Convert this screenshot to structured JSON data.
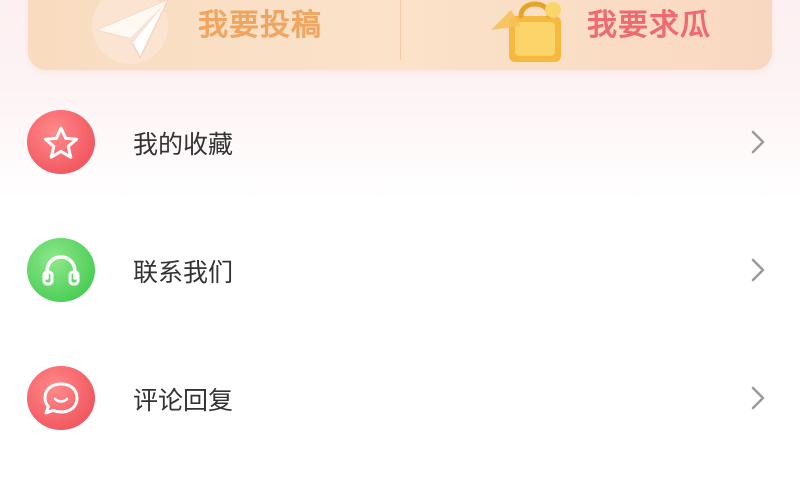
{
  "banner": {
    "submit_label": "我要投稿",
    "request_label": "我要求瓜"
  },
  "menu": {
    "items": [
      {
        "label": "我的收藏",
        "icon": "star-icon",
        "color": "#f25a63"
      },
      {
        "label": "联系我们",
        "icon": "headset-icon",
        "color": "#4fcf5a"
      },
      {
        "label": "评论回复",
        "icon": "chat-bubble-icon",
        "color": "#f25a63"
      }
    ]
  },
  "colors": {
    "submit_text": "#f0a560",
    "request_text": "#ee6a70",
    "label_text": "#333333",
    "chevron": "#9a9a9a"
  }
}
